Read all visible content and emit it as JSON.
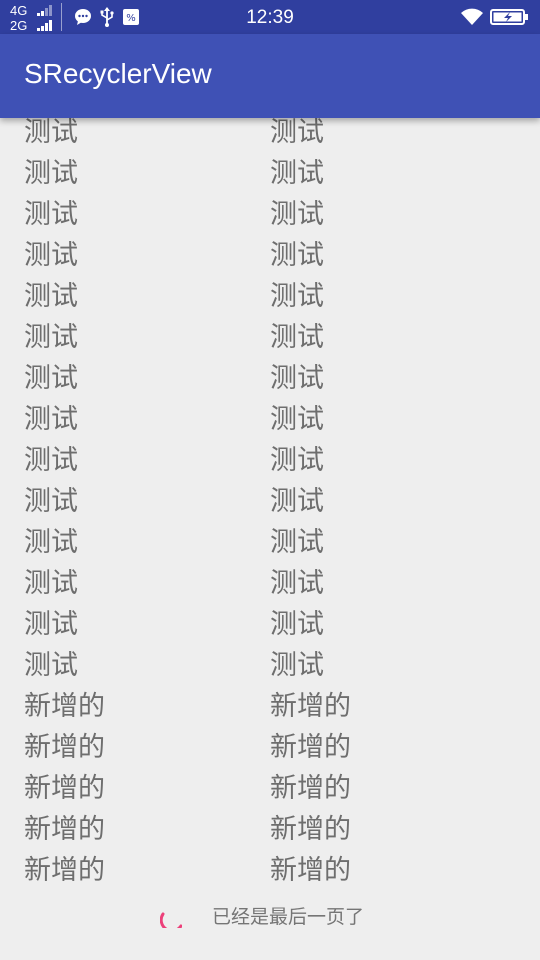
{
  "status_bar": {
    "network_1": "4G",
    "network_2": "2G",
    "time": "12:39",
    "icons": [
      "signal-icon",
      "chat-icon",
      "usb-icon",
      "notification-icon",
      "wifi-icon",
      "battery-icon"
    ]
  },
  "app_bar": {
    "title": "SRecyclerView",
    "color": "#3f51b5"
  },
  "list": {
    "rows": [
      {
        "left": "测试",
        "right": "测试"
      },
      {
        "left": "测试",
        "right": "测试"
      },
      {
        "left": "测试",
        "right": "测试"
      },
      {
        "left": "测试",
        "right": "测试"
      },
      {
        "left": "测试",
        "right": "测试"
      },
      {
        "left": "测试",
        "right": "测试"
      },
      {
        "left": "测试",
        "right": "测试"
      },
      {
        "left": "测试",
        "right": "测试"
      },
      {
        "left": "测试",
        "right": "测试"
      },
      {
        "left": "测试",
        "right": "测试"
      },
      {
        "left": "测试",
        "right": "测试"
      },
      {
        "left": "测试",
        "right": "测试"
      },
      {
        "left": "测试",
        "right": "测试"
      },
      {
        "left": "测试",
        "right": "测试"
      },
      {
        "left": "新增的",
        "right": "新增的"
      },
      {
        "left": "新增的",
        "right": "新增的"
      },
      {
        "left": "新增的",
        "right": "新增的"
      },
      {
        "left": "新增的",
        "right": "新增的"
      },
      {
        "left": "新增的",
        "right": "新增的"
      }
    ]
  },
  "footer": {
    "text": "已经是最后一页了",
    "spinner_color": "#ec407a"
  }
}
